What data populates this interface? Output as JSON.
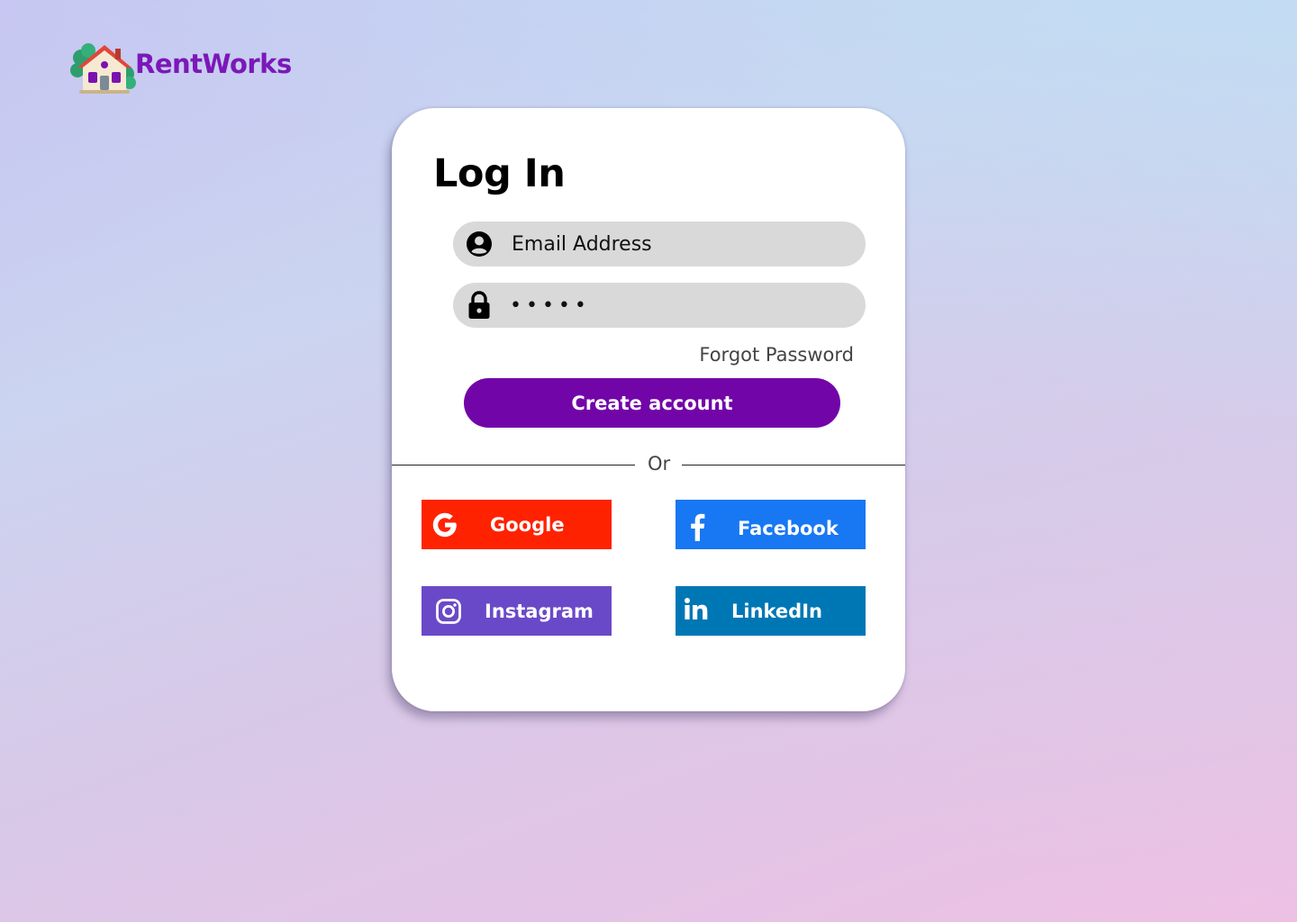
{
  "brand": {
    "name": "RentWorks",
    "logo_icon": "house-icon",
    "color": "#7b18b8"
  },
  "login": {
    "title": "Log In",
    "email": {
      "placeholder": "Email Address",
      "value": "",
      "icon": "user-circle-icon"
    },
    "password": {
      "value": "passw",
      "icon": "lock-icon"
    },
    "forgot_label": "Forgot Password",
    "primary_button": {
      "label": "Create account",
      "color": "#7205a8"
    },
    "divider_label": "Or"
  },
  "social": [
    {
      "label": "Google",
      "icon": "google-icon",
      "color": "#ff2200"
    },
    {
      "label": "Facebook",
      "icon": "facebook-icon",
      "color": "#1877f2"
    },
    {
      "label": "Instagram",
      "icon": "instagram-icon",
      "color": "#6a49c8"
    },
    {
      "label": "LinkedIn",
      "icon": "linkedin-icon",
      "color": "#0077b5"
    }
  ]
}
